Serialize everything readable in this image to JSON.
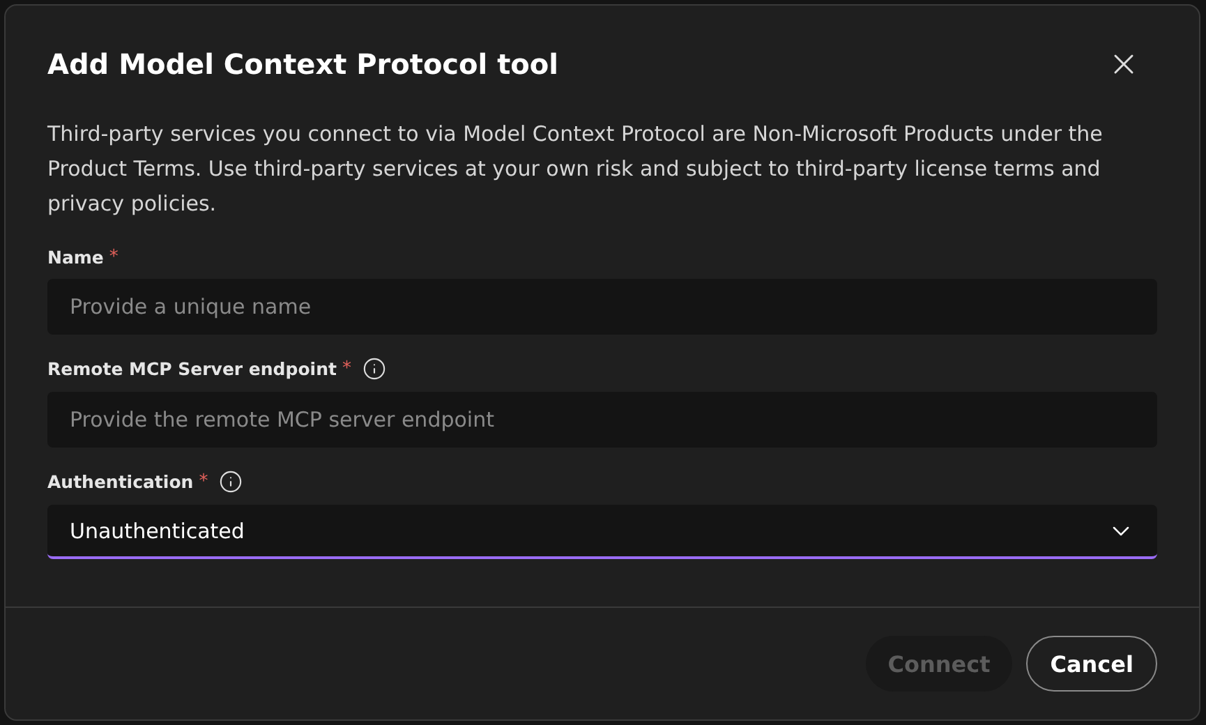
{
  "dialog": {
    "title": "Add Model Context Protocol tool",
    "notice": "Third-party services you connect to via Model Context Protocol are Non-Microsoft Products under the Product Terms. Use third-party services at your own risk and subject to third-party license terms and privacy policies.",
    "fields": [
      {
        "kind": "input",
        "label": "Name",
        "required": true,
        "info": false,
        "placeholder": "Provide a unique name"
      },
      {
        "kind": "input",
        "label": "Remote MCP Server endpoint",
        "required": true,
        "info": true,
        "placeholder": "Provide the remote MCP server endpoint"
      },
      {
        "kind": "select",
        "label": "Authentication",
        "required": true,
        "info": true,
        "value": "Unauthenticated",
        "focused": true
      }
    ],
    "required_mark": "*",
    "buttons": [
      {
        "kind": "primary",
        "label": "Connect",
        "disabled": true
      },
      {
        "kind": "secondary",
        "label": "Cancel",
        "disabled": false
      }
    ]
  }
}
